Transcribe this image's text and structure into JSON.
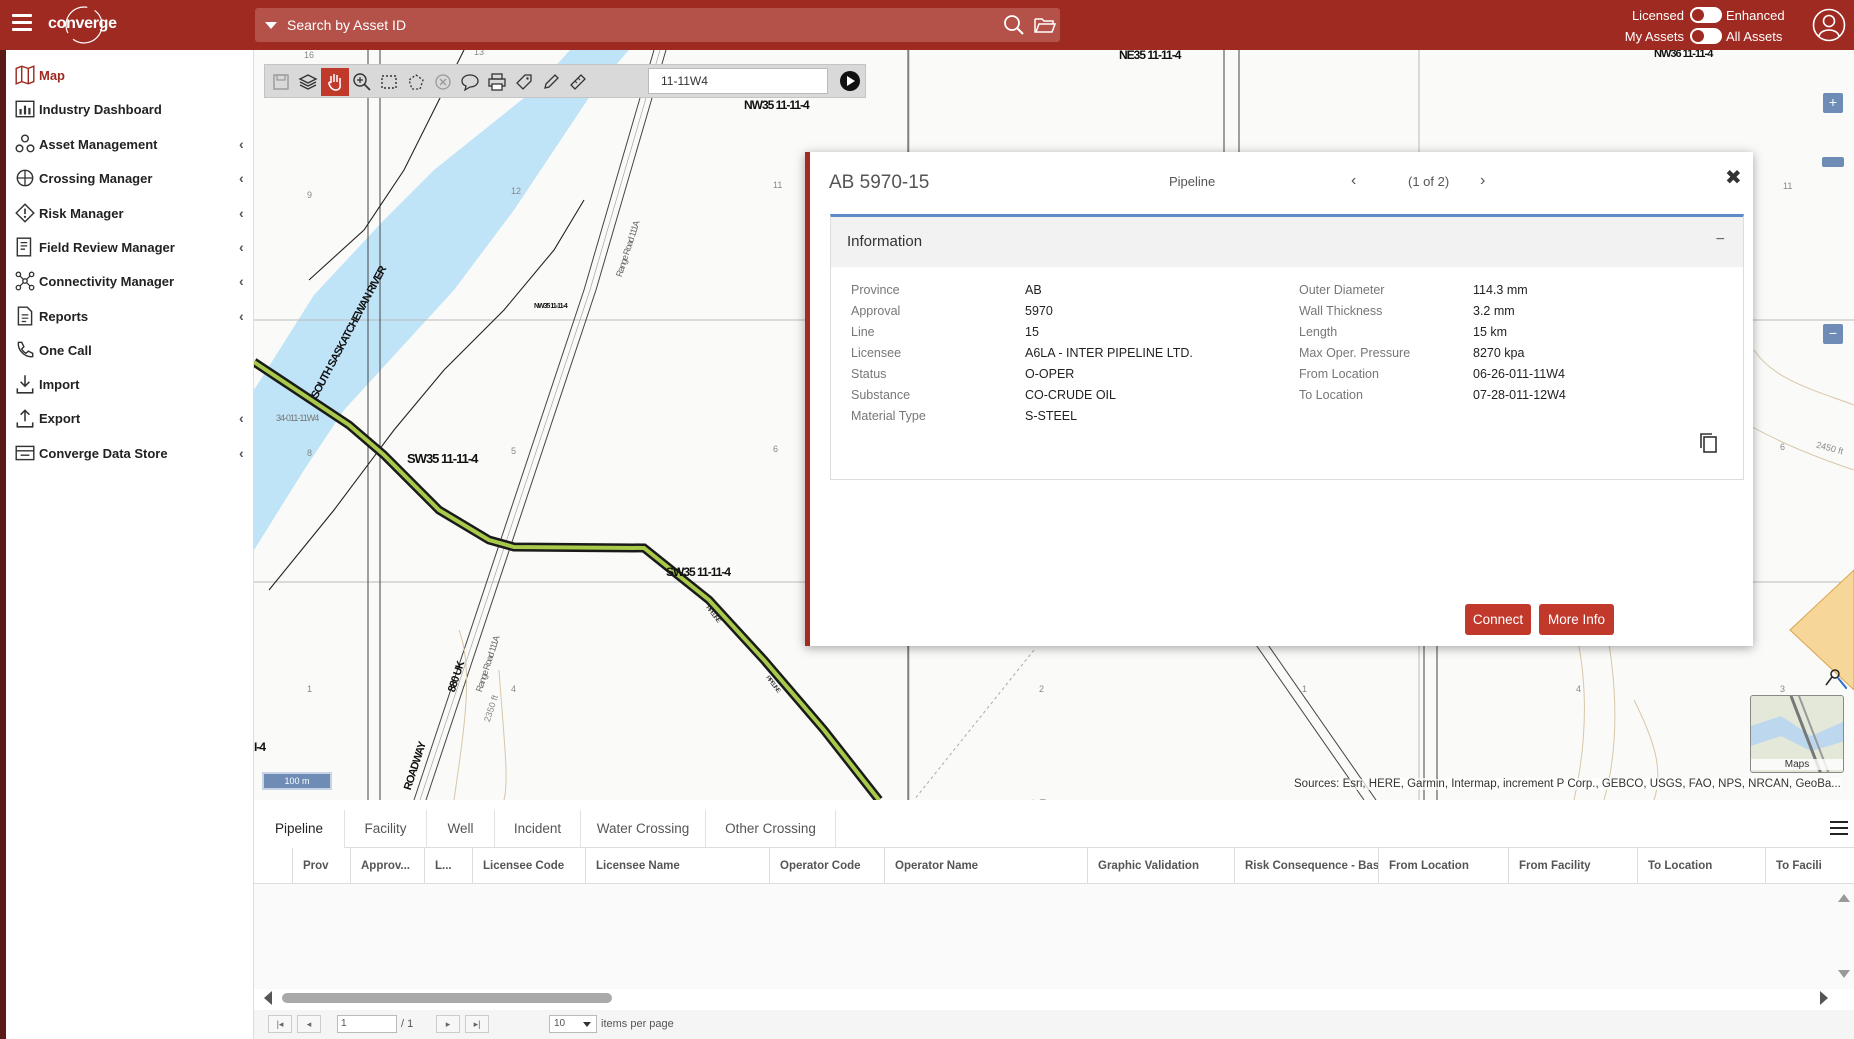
{
  "header": {
    "logo_text": "converge",
    "search_placeholder": "Search by Asset ID",
    "toggle_licensed": "Licensed",
    "toggle_enhanced": "Enhanced",
    "toggle_my_assets": "My Assets",
    "toggle_all_assets": "All Assets"
  },
  "sidebar": {
    "items": [
      {
        "label": "Map",
        "icon": "map-icon",
        "has_submenu": false
      },
      {
        "label": "Industry Dashboard",
        "icon": "dashboard-icon",
        "has_submenu": false
      },
      {
        "label": "Asset Management",
        "icon": "asset-icon",
        "has_submenu": true
      },
      {
        "label": "Crossing Manager",
        "icon": "crossing-icon",
        "has_submenu": true
      },
      {
        "label": "Risk Manager",
        "icon": "risk-icon",
        "has_submenu": true
      },
      {
        "label": "Field Review Manager",
        "icon": "field-review-icon",
        "has_submenu": true
      },
      {
        "label": "Connectivity Manager",
        "icon": "connectivity-icon",
        "has_submenu": true
      },
      {
        "label": "Reports",
        "icon": "reports-icon",
        "has_submenu": true
      },
      {
        "label": "One Call",
        "icon": "phone-icon",
        "has_submenu": false
      },
      {
        "label": "Import",
        "icon": "import-icon",
        "has_submenu": false
      },
      {
        "label": "Export",
        "icon": "export-icon",
        "has_submenu": true
      },
      {
        "label": "Converge Data Store",
        "icon": "data-store-icon",
        "has_submenu": true
      }
    ],
    "chevron": "‹"
  },
  "map": {
    "toolbar_input_value": "11-11W4",
    "labels": {
      "nw35_top": "NW35 11-11-4",
      "ne35_top": "NE35 11-11-4",
      "nw36_top": "NW36 11-11-4",
      "sw35_a": "SW35 11-11-4",
      "sw35_b": "SW35 11-11-4",
      "nw35_small": "NW35 11-11-4",
      "river": "SOUTH SASKATCHEWAN RIVER",
      "range_road_top": "Range Road 111A",
      "range_road_bottom": "Range Road 111A",
      "lsd_34": "34-011-11W4",
      "roadway": "ROADWAY",
      "k880": "880 UK",
      "left_edge": "I-4",
      "contour_2350": "2350 ft",
      "contour_2450": "2450 ft",
      "pipeline_a": "PIPELINE",
      "pipeline_b": "PIPELINE"
    },
    "section_numbers": [
      "16",
      "13",
      "9",
      "12",
      "11",
      "11",
      "8",
      "5",
      "6",
      "6",
      "1",
      "4",
      "2",
      "1",
      "4",
      "3"
    ],
    "scale_label": "100 m",
    "attribution": "Sources: Esri, HERE, Garmin, Intermap, increment P Corp., GEBCO, USGS, FAO, NPS, NRCAN, GeoBa...",
    "basemap_label": "Maps",
    "zoom_in": "+",
    "zoom_out": "−"
  },
  "popup": {
    "title": "AB 5970-15",
    "type": "Pipeline",
    "prev": "‹",
    "count": "(1 of 2)",
    "next": "›",
    "close": "✖",
    "section_title": "Information",
    "collapse": "−",
    "left_fields": [
      {
        "key": "Province",
        "value": "AB"
      },
      {
        "key": "Approval",
        "value": "5970"
      },
      {
        "key": "Line",
        "value": "15"
      },
      {
        "key": "Licensee",
        "value": "A6LA - INTER PIPELINE LTD."
      },
      {
        "key": "Status",
        "value": "O-OPER"
      },
      {
        "key": "Substance",
        "value": "CO-CRUDE OIL"
      },
      {
        "key": "Material Type",
        "value": "S-STEEL"
      }
    ],
    "right_fields": [
      {
        "key": "Outer Diameter",
        "value": "114.3 mm"
      },
      {
        "key": "Wall Thickness",
        "value": "3.2 mm"
      },
      {
        "key": "Length",
        "value": "15 km"
      },
      {
        "key": "Max Oper. Pressure",
        "value": "8270 kpa"
      },
      {
        "key": "From Location",
        "value": "06-26-011-11W4"
      },
      {
        "key": "To Location",
        "value": "07-28-011-12W4"
      }
    ],
    "connect_label": "Connect",
    "more_info_label": "More Info"
  },
  "grid": {
    "tabs": [
      "Pipeline",
      "Facility",
      "Well",
      "Incident",
      "Water Crossing",
      "Other Crossing"
    ],
    "active_tab": "Pipeline",
    "columns": [
      "Prov",
      "Approv...",
      "L...",
      "Licensee Code",
      "Licensee Name",
      "Operator Code",
      "Operator Name",
      "Graphic Validation",
      "Risk Consequence - Base...",
      "From Location",
      "From Facility",
      "To Location",
      "To Facili"
    ],
    "pager": {
      "page_value": "1",
      "of_pages": "/ 1",
      "per_page": "10",
      "per_page_label": "items per page",
      "first": "|◂",
      "prev": "◂",
      "next": "▸",
      "last": "▸|"
    }
  },
  "colors": {
    "brand": "#9e2a22",
    "accent_blue": "#5b8bc9",
    "button_red": "#c0392b"
  }
}
